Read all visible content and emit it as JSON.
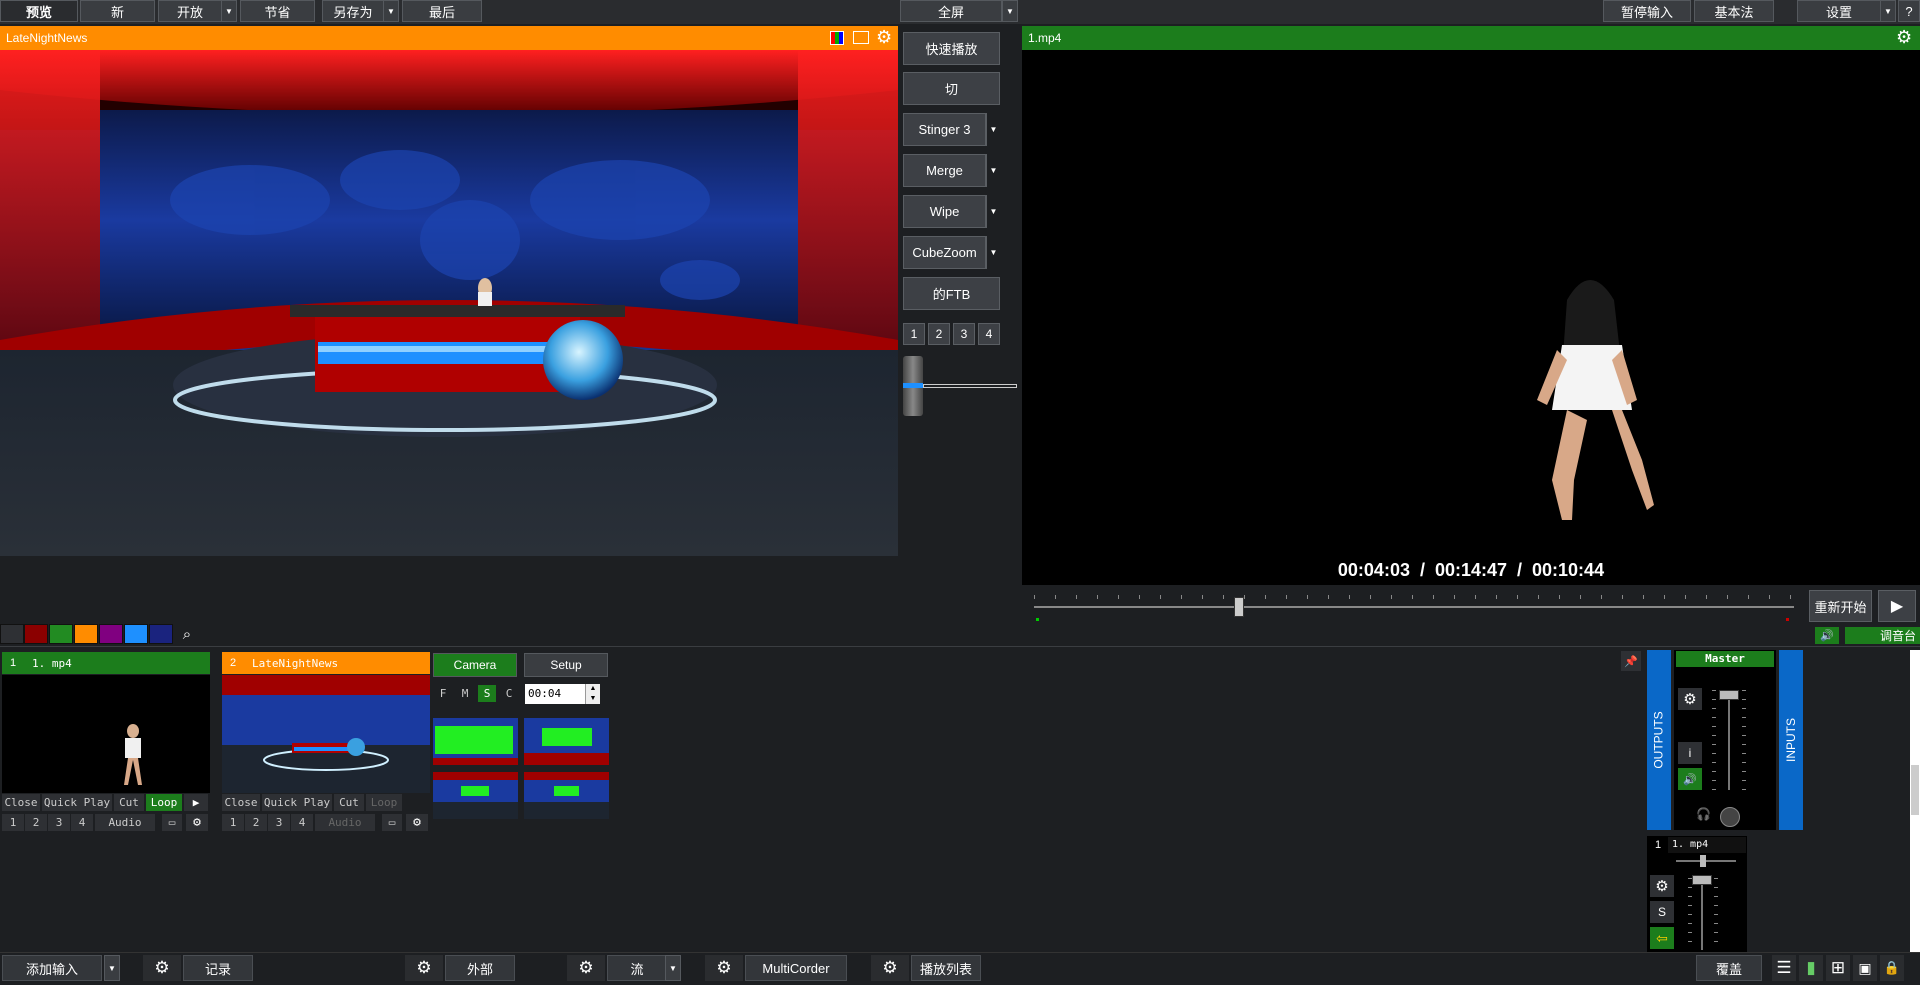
{
  "toolbar": {
    "preview": "预览",
    "new": "新",
    "open": "开放",
    "save": "节省",
    "save_as": "另存为",
    "last": "最后",
    "fullscreen": "全屏",
    "pause_input": "暂停输入",
    "basic": "基本法",
    "settings": "设置",
    "help": "?"
  },
  "preview_panel": {
    "title": "LateNightNews"
  },
  "output_panel": {
    "title": "1.mp4"
  },
  "transitions": {
    "quick_play": "快速播放",
    "cut": "切",
    "t1": "Stinger 3",
    "t2": "Merge",
    "t3": "Wipe",
    "t4": "CubeZoom",
    "ftb": "的FTB",
    "nums": [
      "1",
      "2",
      "3",
      "4"
    ]
  },
  "player": {
    "time": "00:04:03  /  00:14:47  /  00:10:44",
    "restart": "重新开始",
    "play_icon": "▶",
    "progress": 0.27
  },
  "audio": {
    "mixer_label": "调音台"
  },
  "swatch_colors": [
    "#2e3034",
    "#8b0000",
    "#228b22",
    "#ff8c00",
    "#800080",
    "#1e90ff",
    "#1a237e"
  ],
  "inputs": [
    {
      "num": "1",
      "title": "1. mp4",
      "color": "#1c7d1c",
      "buttons": [
        "Close",
        "Quick Play",
        "Cut",
        "Loop"
      ],
      "sub": [
        "1",
        "2",
        "3",
        "4",
        "Audio"
      ]
    },
    {
      "num": "2",
      "title": "LateNightNews",
      "color": "#ff8c00",
      "buttons": [
        "Close",
        "Quick Play",
        "Cut",
        "Loop"
      ],
      "sub": [
        "1",
        "2",
        "3",
        "4",
        "Audio"
      ]
    }
  ],
  "camera": {
    "tab_camera": "Camera",
    "tab_setup": "Setup",
    "modes": [
      "F",
      "M",
      "S",
      "C"
    ],
    "duration": "00:04"
  },
  "mixer": {
    "outputs": "OUTPUTS",
    "inputs": "INPUTS",
    "master": "Master",
    "i_label": "i",
    "ch1": "1",
    "ch1_name": "1. mp4",
    "s_label": "S"
  },
  "bottom": {
    "add_input": "添加输入",
    "record": "记录",
    "external": "外部",
    "stream": "流",
    "multicorder": "MultiCorder",
    "playlist": "播放列表",
    "overlay": "覆盖"
  }
}
